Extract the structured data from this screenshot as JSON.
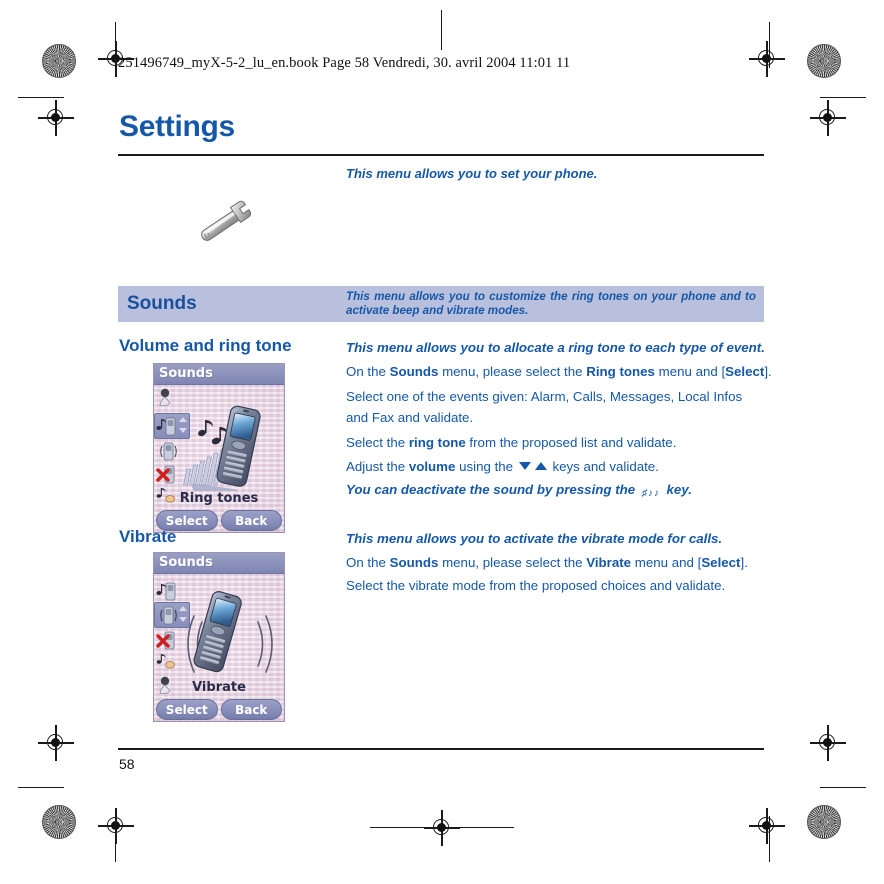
{
  "print": {
    "book_header": "251496749_myX-5-2_lu_en.book  Page 58  Vendredi, 30. avril 2004  11:01 11"
  },
  "document": {
    "chapter_title": "Settings",
    "intro": "This menu allows you to set your phone.",
    "chapter_icon": "wrench-icon",
    "page_number": "58"
  },
  "section": {
    "name": "Sounds",
    "description": "This menu allows you to customize the ring tones on your phone and to activate beep and vibrate modes."
  },
  "subsections": [
    {
      "heading": "Volume and ring tone",
      "lines": [
        {
          "type": "italic",
          "text": "This menu allows you to allocate a ring tone to each type of event."
        },
        {
          "type": "rich",
          "html": "On the <b>Sounds</b> menu, please select the <b>Ring tones</b> menu and [<b>Select</b>]."
        },
        {
          "type": "wrap",
          "html": "Select one of the events given: Alarm, Calls, Messages, Local Infos and Fax and validate."
        },
        {
          "type": "rich",
          "html": "Select the <b>ring tone</b> from the proposed list and validate."
        },
        {
          "type": "keys",
          "html": "Adjust the <b>volume</b> using the ARROWS keys and validate."
        },
        {
          "type": "italickey",
          "html": "You can deactivate the sound by pressing the KEY key."
        }
      ],
      "screenshot": {
        "title": "Sounds",
        "label": "Ring tones",
        "softkeys": [
          "Select",
          "Back"
        ],
        "sidebar_icons": [
          "microphone-icon",
          "ring-tone-icon",
          "vibrate-icon",
          "mute-icon",
          "beep-icon"
        ],
        "selected_index": 1
      }
    },
    {
      "heading": "Vibrate",
      "lines": [
        {
          "type": "italic",
          "text": "This menu allows you to activate the vibrate mode for calls."
        },
        {
          "type": "rich",
          "html": "On the <b>Sounds</b> menu, please select the <b>Vibrate</b> menu and [<b>Select</b>]."
        },
        {
          "type": "rich",
          "html": "Select the vibrate mode from the proposed choices and validate."
        }
      ],
      "screenshot": {
        "title": "Sounds",
        "label": "Vibrate",
        "softkeys": [
          "Select",
          "Back"
        ],
        "sidebar_icons": [
          "ring-tone-icon",
          "vibrate-icon",
          "mute-icon",
          "beep-icon",
          "microphone-icon"
        ],
        "selected_index": 1
      }
    }
  ],
  "colors": {
    "brand_blue": "#1658a8",
    "section_bar_bg": "#b9c0dd",
    "section_bar_text": "#1a4f9c",
    "phone_titlebar": "#8c91bb",
    "phone_screen_bg": "#e2cfdf"
  }
}
